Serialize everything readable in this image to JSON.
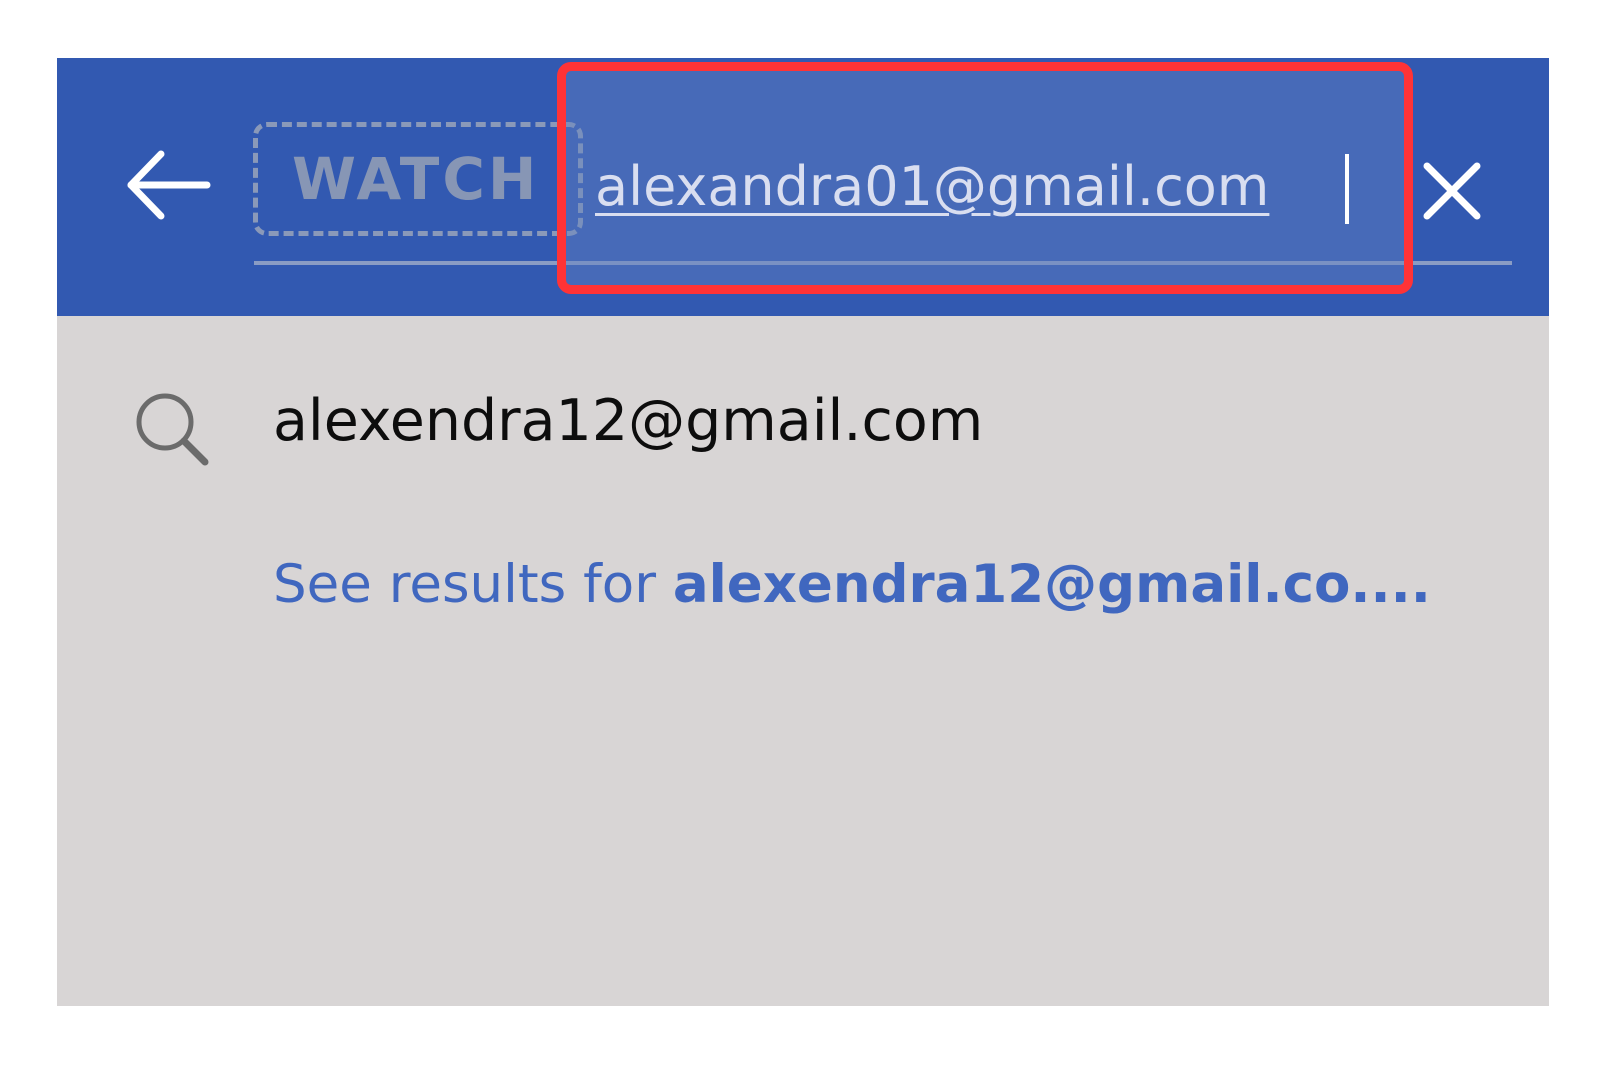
{
  "search_bar": {
    "chip_label": "WATCH",
    "query": "alexandra01@gmail.com",
    "colors": {
      "bar": "#3259b1",
      "highlight_border": "#ff3336"
    }
  },
  "icons": {
    "back": "arrow-left-icon",
    "clear": "close-icon",
    "suggestion": "search-icon"
  },
  "suggestions": [
    {
      "text": "alexendra12@gmail.com"
    }
  ],
  "see_results": {
    "prefix": "See results for ",
    "query": "alexendra12@gmail.co...."
  }
}
